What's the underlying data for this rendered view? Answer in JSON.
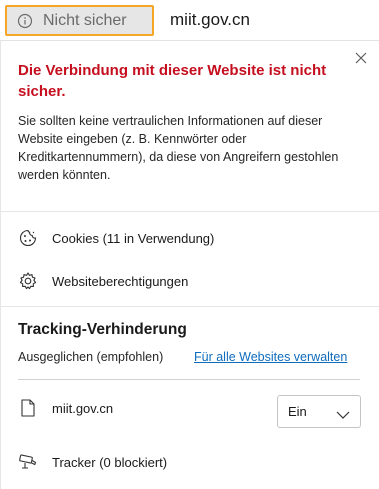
{
  "address_bar": {
    "security_label": "Nicht sicher",
    "security_icon": "info-icon",
    "domain": "miit.gov.cn",
    "chip_border_color": "#f5a623"
  },
  "flyout": {
    "close_icon": "close-icon",
    "warning_title": "Die Verbindung mit dieser Website ist nicht sicher.",
    "warning_text": "Sie sollten keine vertraulichen Informationen auf dieser Website eingeben (z. B. Kennwörter oder Kreditkartennummern), da diese von Angreifern gestohlen werden könnten.",
    "warning_color": "#c50f1f",
    "items": [
      {
        "icon": "cookie-icon",
        "label": "Cookies (11 in Verwendung)"
      },
      {
        "icon": "gear-icon",
        "label": "Websiteberechtigungen"
      }
    ],
    "tracking": {
      "title": "Tracking-Verhinderung",
      "level": "Ausgeglichen (empfohlen)",
      "manage_link": "Für alle Websites verwalten",
      "link_color": "#0f6cbd",
      "site": {
        "icon": "document-icon",
        "domain": "miit.gov.cn",
        "select_value": "Ein"
      },
      "trackers": {
        "icon": "camera-icon",
        "label": "Tracker (0 blockiert)"
      }
    }
  }
}
